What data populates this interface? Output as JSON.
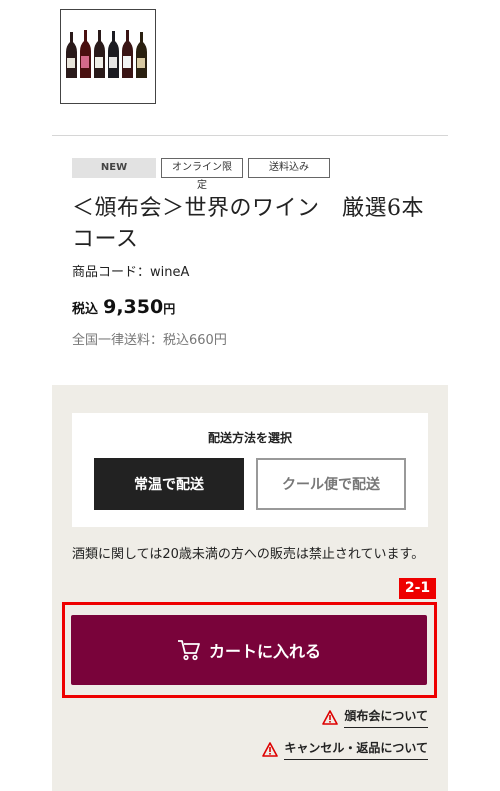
{
  "product": {
    "badges": [
      "NEW",
      "オンライン限定",
      "送料込み"
    ],
    "title": "＜頒布会＞世界のワイン　厳選6本コース",
    "code": "商品コード：wineA",
    "price_prefix": "税込",
    "price_value": "9,350",
    "price_unit": "円",
    "shipping_fee": "全国一律送料：税込660円"
  },
  "shipping": {
    "title": "配送方法を選択",
    "options": [
      "常温で配送",
      "クール便で配送"
    ],
    "selected": "常温で配送"
  },
  "notice": "酒類に関しては20歳未満の方への販売は禁止されています。",
  "annotation_tag": "2-1",
  "cart": {
    "label": "カートに入れる"
  },
  "links": [
    "頒布会について",
    "キャンセル・返品について"
  ],
  "colors": {
    "cart": "#79033a",
    "highlight": "#e00000",
    "panel": "#efede7",
    "selected_option": "#222222"
  },
  "thumbnail": {
    "bottles": 6
  }
}
